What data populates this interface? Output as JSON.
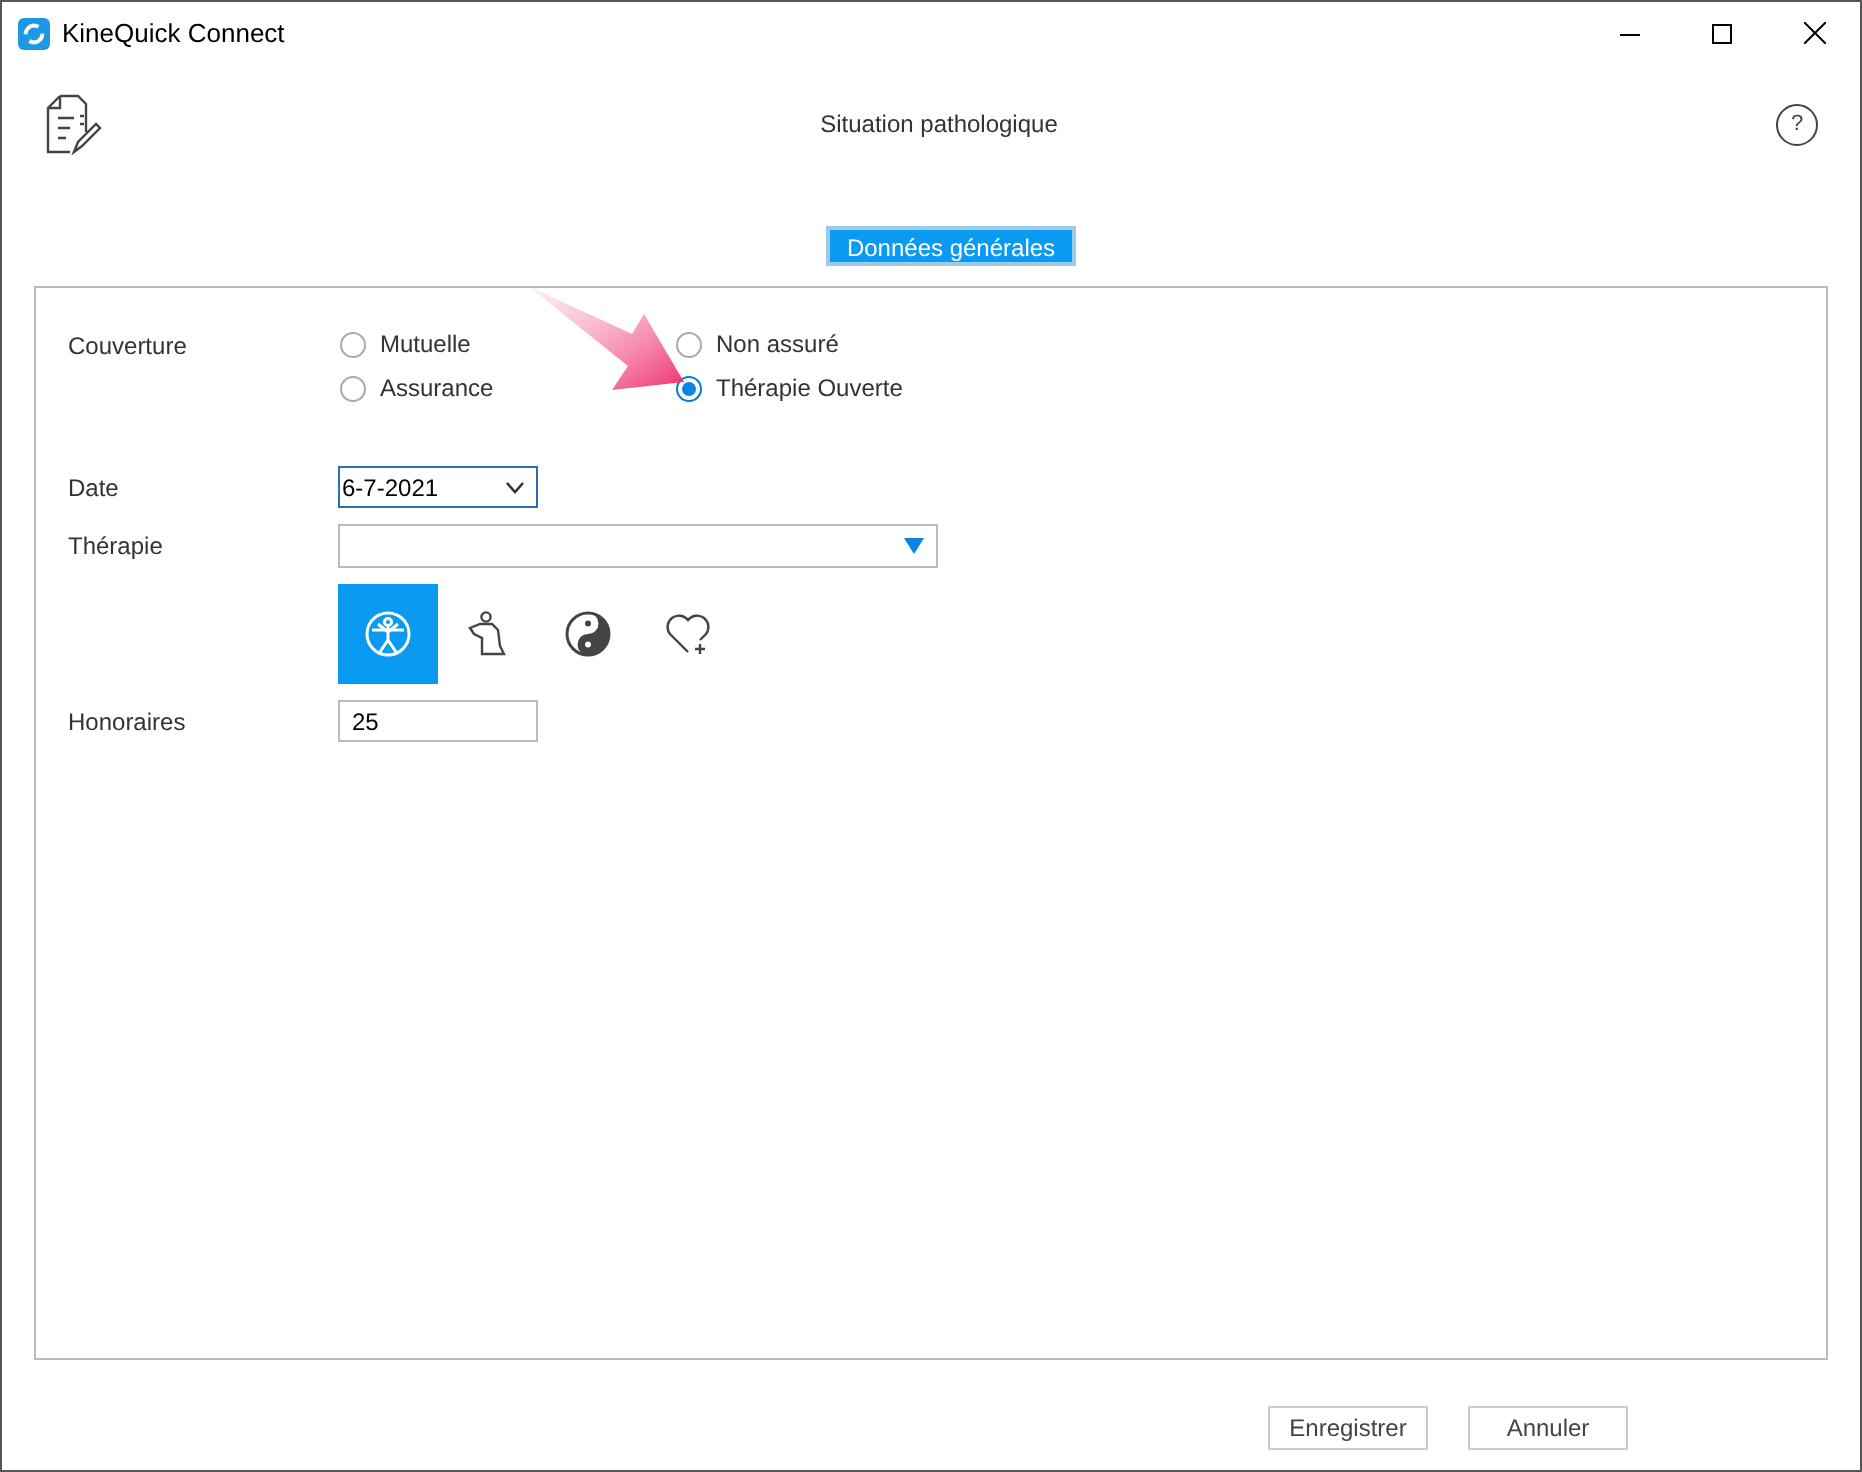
{
  "window": {
    "title": "KineQuick Connect"
  },
  "header": {
    "title": "Situation pathologique",
    "help": "?"
  },
  "tabs": [
    {
      "label": "Données générales",
      "selected": true
    }
  ],
  "coverage": {
    "label": "Couverture",
    "options": [
      {
        "label": "Mutuelle",
        "selected": false
      },
      {
        "label": "Non assuré",
        "selected": false
      },
      {
        "label": "Assurance",
        "selected": false
      },
      {
        "label": "Thérapie Ouverte",
        "selected": true
      }
    ]
  },
  "date": {
    "label": "Date",
    "value": "6-7-2021"
  },
  "therapy": {
    "label": "Thérapie",
    "types": [
      {
        "kind": "vitruvian",
        "selected": true
      },
      {
        "kind": "body",
        "selected": false
      },
      {
        "kind": "yinyang",
        "selected": false
      },
      {
        "kind": "heart",
        "selected": false
      }
    ]
  },
  "fees": {
    "label": "Honoraires",
    "value": "25"
  },
  "buttons": [
    "Enregistrer",
    "Annuler"
  ]
}
